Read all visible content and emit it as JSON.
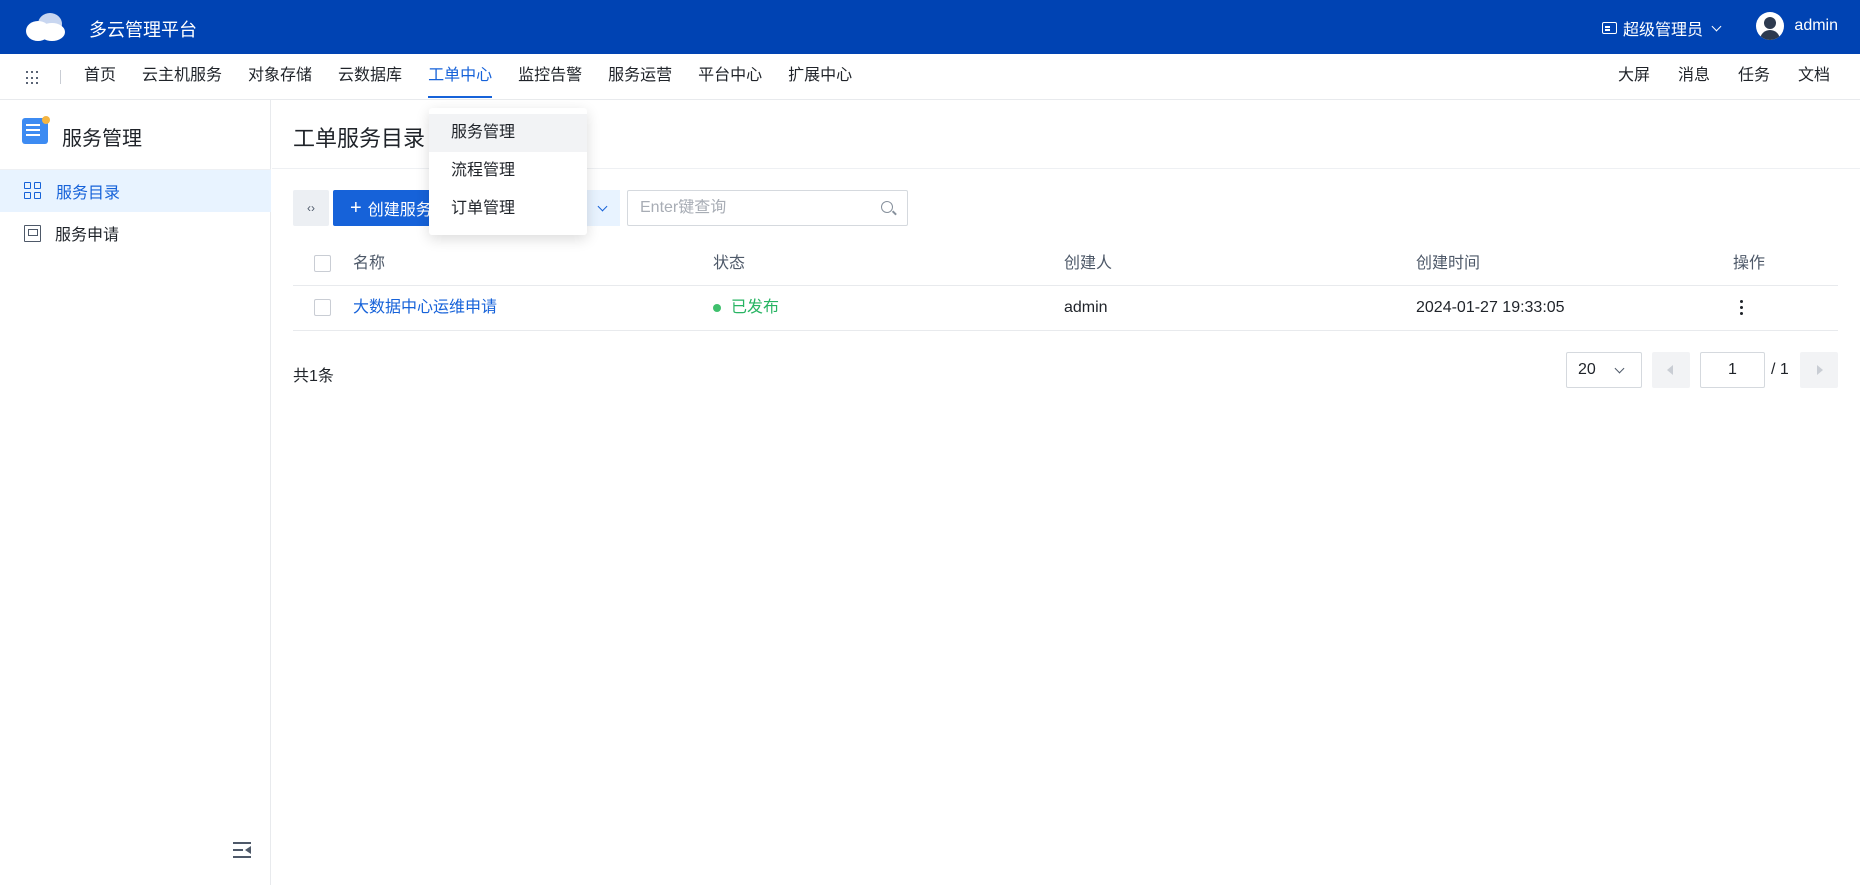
{
  "header": {
    "app_title": "多云管理平台",
    "role_label": "超级管理员",
    "username": "admin"
  },
  "nav": {
    "items": [
      {
        "label": "首页",
        "active": false
      },
      {
        "label": "云主机服务",
        "active": false
      },
      {
        "label": "对象存储",
        "active": false
      },
      {
        "label": "云数据库",
        "active": false
      },
      {
        "label": "工单中心",
        "active": true
      },
      {
        "label": "监控告警",
        "active": false
      },
      {
        "label": "服务运营",
        "active": false
      },
      {
        "label": "平台中心",
        "active": false
      },
      {
        "label": "扩展中心",
        "active": false
      }
    ],
    "right_items": [
      "大屏",
      "消息",
      "任务",
      "文档"
    ]
  },
  "dropdown": {
    "items": [
      "服务管理",
      "流程管理",
      "订单管理"
    ]
  },
  "sidebar": {
    "title": "服务管理",
    "items": [
      {
        "label": "服务目录",
        "active": true
      },
      {
        "label": "服务申请",
        "active": false
      }
    ]
  },
  "main": {
    "page_title": "工单服务目录",
    "refresh_label": "‹›",
    "create_button": "创建服务",
    "search_placeholder": "Enter键查询",
    "table": {
      "columns": [
        "名称",
        "状态",
        "创建人",
        "创建时间",
        "操作"
      ],
      "rows": [
        {
          "name": "大数据中心运维申请",
          "status": "已发布",
          "creator": "admin",
          "created_at": "2024-01-27 19:33:05"
        }
      ]
    },
    "total_text": "共1条",
    "pagination": {
      "page_size": "20",
      "current_page": "1",
      "total_pages": "/ 1"
    }
  },
  "colors": {
    "header_bg": "#0043b3",
    "accent": "#1662d9",
    "status_published": "#28b463"
  }
}
